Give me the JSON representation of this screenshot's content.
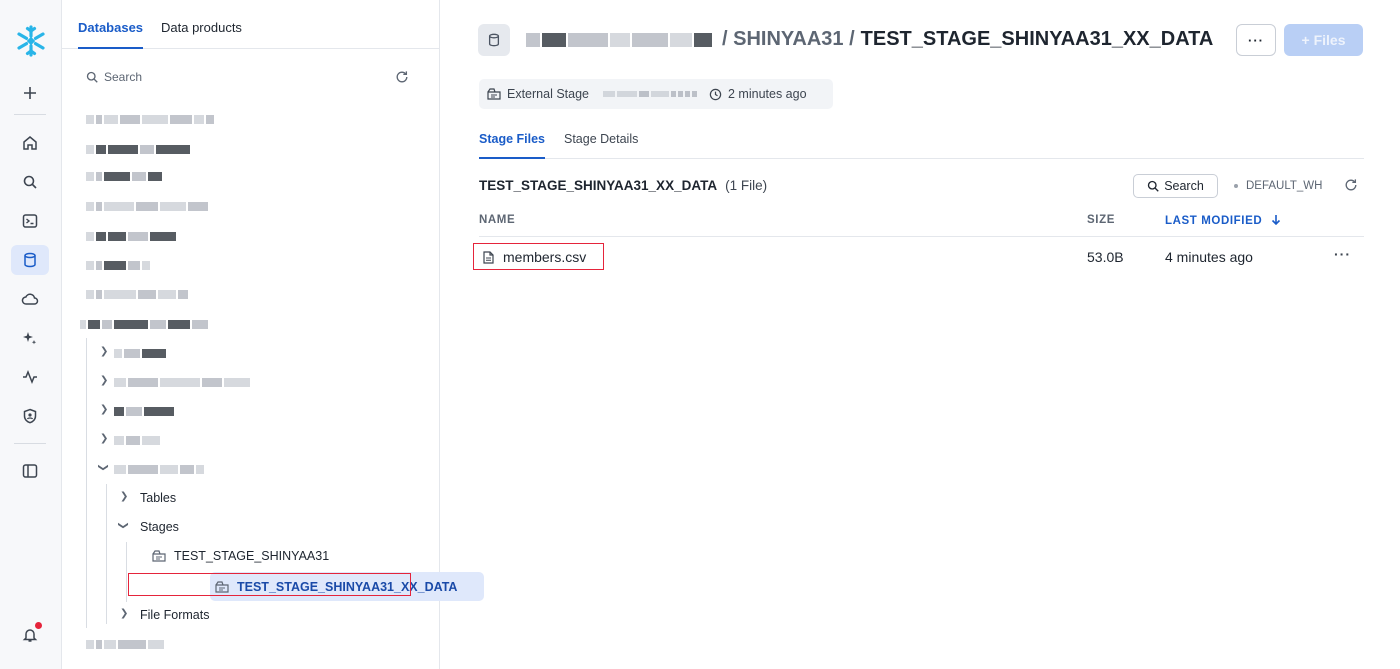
{
  "rail": {
    "icons": [
      "snowflake-logo",
      "plus-icon",
      "home-icon",
      "search-icon",
      "worksheet-icon",
      "database-icon",
      "cloud-icon",
      "sparkle-icon",
      "activity-icon",
      "shield-icon",
      "panel-icon",
      "bell-icon"
    ],
    "active": "database-icon"
  },
  "tree": {
    "tabs": [
      {
        "label": "Databases",
        "active": true
      },
      {
        "label": "Data products",
        "active": false
      }
    ],
    "search_placeholder": "Search",
    "tables_label": "Tables",
    "stages_label": "Stages",
    "stage_items": [
      "TEST_STAGE_SHINYAA31",
      "TEST_STAGE_SHINYAA31_XX_DATA"
    ],
    "selected_stage": "TEST_STAGE_SHINYAA31_XX_DATA",
    "file_formats_label": "File Formats"
  },
  "header": {
    "schema": "/ SHINYAA31 /",
    "stage_name": "TEST_STAGE_SHINYAA31_XX_DATA",
    "more_label": "···",
    "files_button": "+ Files",
    "stage_type": "External Stage",
    "updated": "2 minutes ago"
  },
  "main_tabs": [
    {
      "label": "Stage Files",
      "active": true
    },
    {
      "label": "Stage Details",
      "active": false
    }
  ],
  "files": {
    "title": "TEST_STAGE_SHINYAA31_XX_DATA",
    "count": "(1 File)",
    "search_label": "Search",
    "warehouse": "DEFAULT_WH",
    "columns": {
      "name": "NAME",
      "size": "SIZE",
      "modified": "LAST MODIFIED"
    },
    "rows": [
      {
        "name": "members.csv",
        "size": "53.0B",
        "modified": "4 minutes ago"
      }
    ]
  },
  "colors": {
    "accent": "#1a5cc8",
    "highlight": "#e5243b",
    "selected_bg": "#dfe8fb"
  }
}
